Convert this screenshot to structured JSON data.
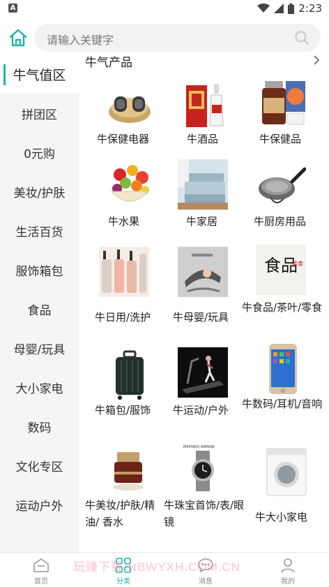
{
  "status_bar": {
    "app_icon_letter": "A",
    "time": "2:23"
  },
  "search": {
    "placeholder": "请输入关键字"
  },
  "sidebar": {
    "items": [
      {
        "label": "牛气值区",
        "active": true
      },
      {
        "label": "拼团区"
      },
      {
        "label": "0元购"
      },
      {
        "label": "美妆/护肤"
      },
      {
        "label": "生活百货"
      },
      {
        "label": "服饰箱包"
      },
      {
        "label": "食品"
      },
      {
        "label": "母婴/玩具"
      },
      {
        "label": "大小家电"
      },
      {
        "label": "数码"
      },
      {
        "label": "文化专区"
      },
      {
        "label": "运动户外"
      }
    ]
  },
  "main": {
    "section_title": "牛气产品",
    "products": [
      {
        "label": "牛保健电器",
        "icon": "foot-massager-image"
      },
      {
        "label": "牛酒品",
        "icon": "liquor-box-image"
      },
      {
        "label": "牛保健品",
        "icon": "supplement-bottle-image"
      },
      {
        "label": "牛水果",
        "icon": "fruit-basket-image"
      },
      {
        "label": "牛家居",
        "icon": "bedroom-image"
      },
      {
        "label": "牛厨房用品",
        "icon": "wok-pan-image"
      },
      {
        "label": "牛日用/洗护",
        "icon": "toiletry-bottles-image"
      },
      {
        "label": "牛母婴/玩具",
        "icon": "baby-rocker-image"
      },
      {
        "label": "牛食品/茶叶/零食",
        "icon": "food-calligraphy-image",
        "calligraphy": "食品",
        "seal": "美食"
      },
      {
        "label": "牛箱包/服饰",
        "icon": "suitcase-image"
      },
      {
        "label": "牛运动/户外",
        "icon": "treadmill-image"
      },
      {
        "label": "牛数码/耳机/音响",
        "icon": "smartphone-image"
      },
      {
        "label": "牛美妆/护肤/精油/ 香水",
        "icon": "cosmetic-jar-image"
      },
      {
        "label": "牛珠宝首饰/表/眼镜",
        "icon": "wristwatch-image",
        "brand": "EMPORIO ARMANI"
      },
      {
        "label": "牛大小家电",
        "icon": "washing-machine-image"
      }
    ]
  },
  "bottom_nav": {
    "tabs": [
      {
        "label": "首页",
        "icon": "home-icon"
      },
      {
        "label": "分类",
        "icon": "grid-icon",
        "active": true
      },
      {
        "label": "消息",
        "icon": "chat-icon"
      },
      {
        "label": "我的",
        "icon": "user-icon"
      }
    ],
    "watermark": "玩赚下载-NBWYXH.COM.CN"
  },
  "colors": {
    "accent": "#1bb5a8",
    "sidebar_bg": "#f5f5f5",
    "search_bg": "#f2f2f2"
  }
}
